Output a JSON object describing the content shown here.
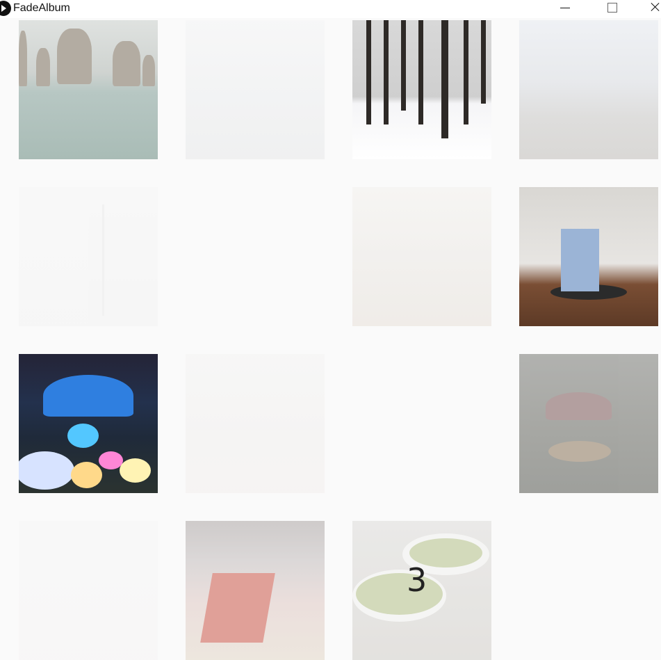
{
  "window": {
    "title": "FadeAlbum",
    "controls": {
      "minimize": "minimize-icon",
      "maximize": "maximize-icon",
      "close": "close-icon"
    }
  },
  "album": {
    "rows": [
      [
        {
          "visible": true,
          "subject": "sea-arch-rocks"
        },
        {
          "visible": true,
          "subject": "harbor"
        },
        {
          "visible": true,
          "subject": "snowy-forest"
        },
        {
          "visible": true,
          "subject": "park-path"
        }
      ],
      [
        {
          "visible": true,
          "subject": "street-lamp"
        },
        {
          "visible": false
        },
        {
          "visible": true,
          "subject": "campus-autumn"
        },
        {
          "visible": true,
          "subject": "gallery-installation"
        }
      ],
      [
        {
          "visible": true,
          "subject": "illuminated-garden"
        },
        {
          "visible": true,
          "subject": "light-tunnel"
        },
        {
          "visible": false
        },
        {
          "visible": true,
          "subject": "carousel"
        }
      ],
      [
        {
          "visible": true,
          "subject": "cakes"
        },
        {
          "visible": true,
          "subject": "cake-display"
        },
        {
          "visible": true,
          "subject": "matcha-cups",
          "label": "3"
        },
        {
          "visible": false
        }
      ]
    ],
    "opacities": [
      [
        1.0,
        0.35,
        1.0,
        0.55
      ],
      [
        0.25,
        0.0,
        0.35,
        1.0
      ],
      [
        1.0,
        0.3,
        0.0,
        0.65
      ],
      [
        0.2,
        0.7,
        0.75,
        0.0
      ]
    ]
  }
}
